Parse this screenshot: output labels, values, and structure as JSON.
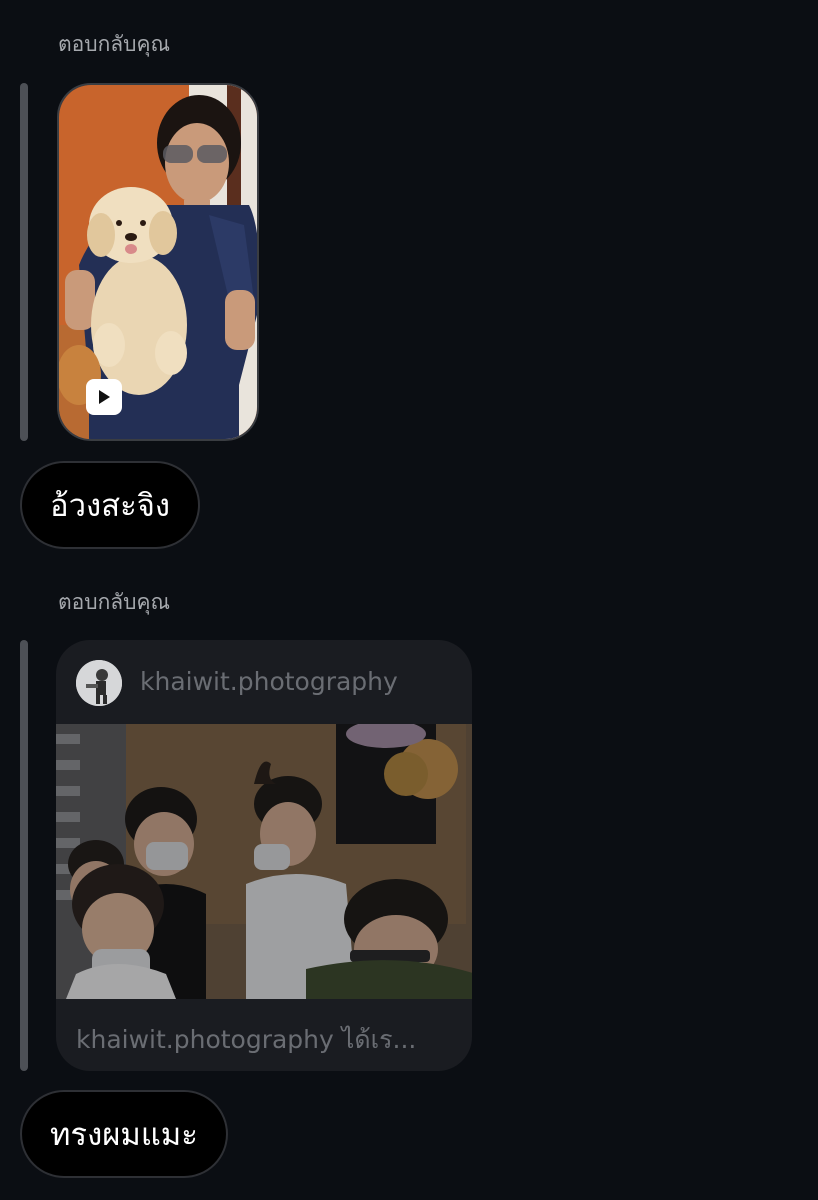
{
  "messages": [
    {
      "reply_label": "ตอบกลับคุณ",
      "attachment": {
        "type": "reel",
        "badge_icon": "play-icon"
      },
      "text": "อ้วงสะจิง"
    },
    {
      "reply_label": "ตอบกลับคุณ",
      "attachment": {
        "type": "post",
        "username": "khaiwit.photography",
        "caption": "khaiwit.photography ได้เร..."
      },
      "text": "ทรงผมแมะ"
    }
  ],
  "colors": {
    "background": "#0b0e13",
    "reply_bar": "#4d5056",
    "bubble": "#000000",
    "card": "#1a1c21",
    "muted_text": "#6a6d73"
  }
}
